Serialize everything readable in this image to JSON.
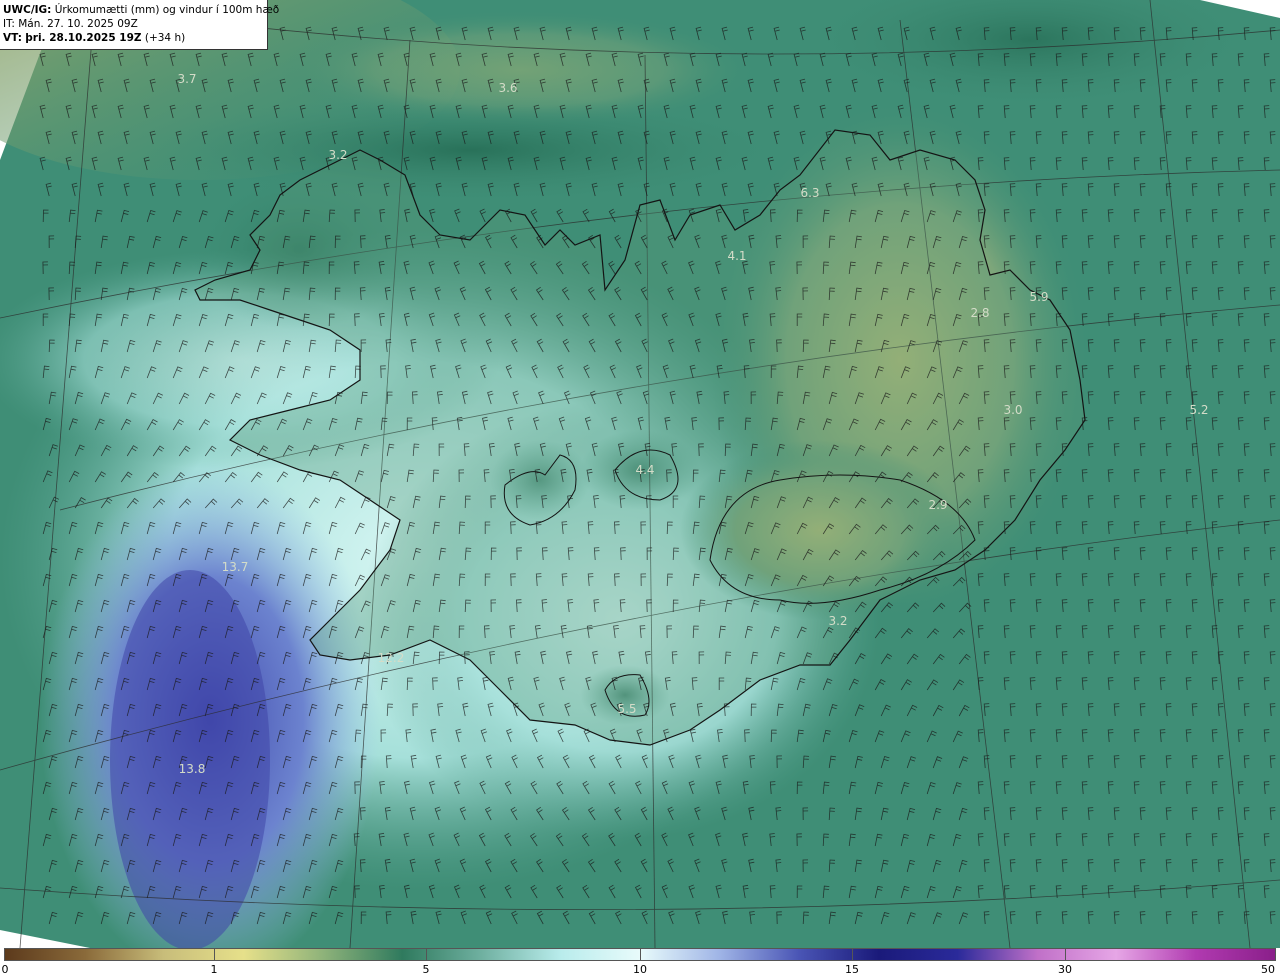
{
  "header": {
    "product": "UWC/IG:",
    "title": "Úrkomumætti (mm) og vindur í 100m hæð",
    "it_prefix": "IT:",
    "it_value": "Mán. 27. 10. 2025 09Z",
    "vt_prefix": "VT:",
    "vt_value": "þri. 28.10.2025 19Z",
    "vt_offset": "(+34 h)"
  },
  "value_labels": [
    "3.7",
    "3.6",
    "3.2",
    "6.3",
    "4.1",
    "5.9",
    "2.8",
    "3.0",
    "5.2",
    "4.4",
    "2.9",
    "13.7",
    "12.2",
    "3.2",
    "5.5",
    "13.8"
  ],
  "colorbar": {
    "ticks": [
      "0",
      "1",
      "5",
      "10",
      "15",
      "30",
      "50"
    ],
    "colors": [
      "#5c3a1c",
      "#8a6a3a",
      "#c8bd7a",
      "#e6e08a",
      "#8fb37a",
      "#2f7a5e",
      "#6fb0a0",
      "#b9ecec",
      "#e8fbfb",
      "#9fb4e6",
      "#4a55b5",
      "#1a1a7a",
      "#2a2a9a",
      "#c070c8",
      "#e6a6e6",
      "#b03ab0",
      "#8a1f8a"
    ]
  },
  "colors": {
    "ocean": "#3f8e76",
    "land_high": "#a9b36e",
    "precip_low": "#b4e8e4",
    "precip_high": "#4a55b5",
    "coastline": "#1a1a1a",
    "barb": "#1a1a1a"
  }
}
